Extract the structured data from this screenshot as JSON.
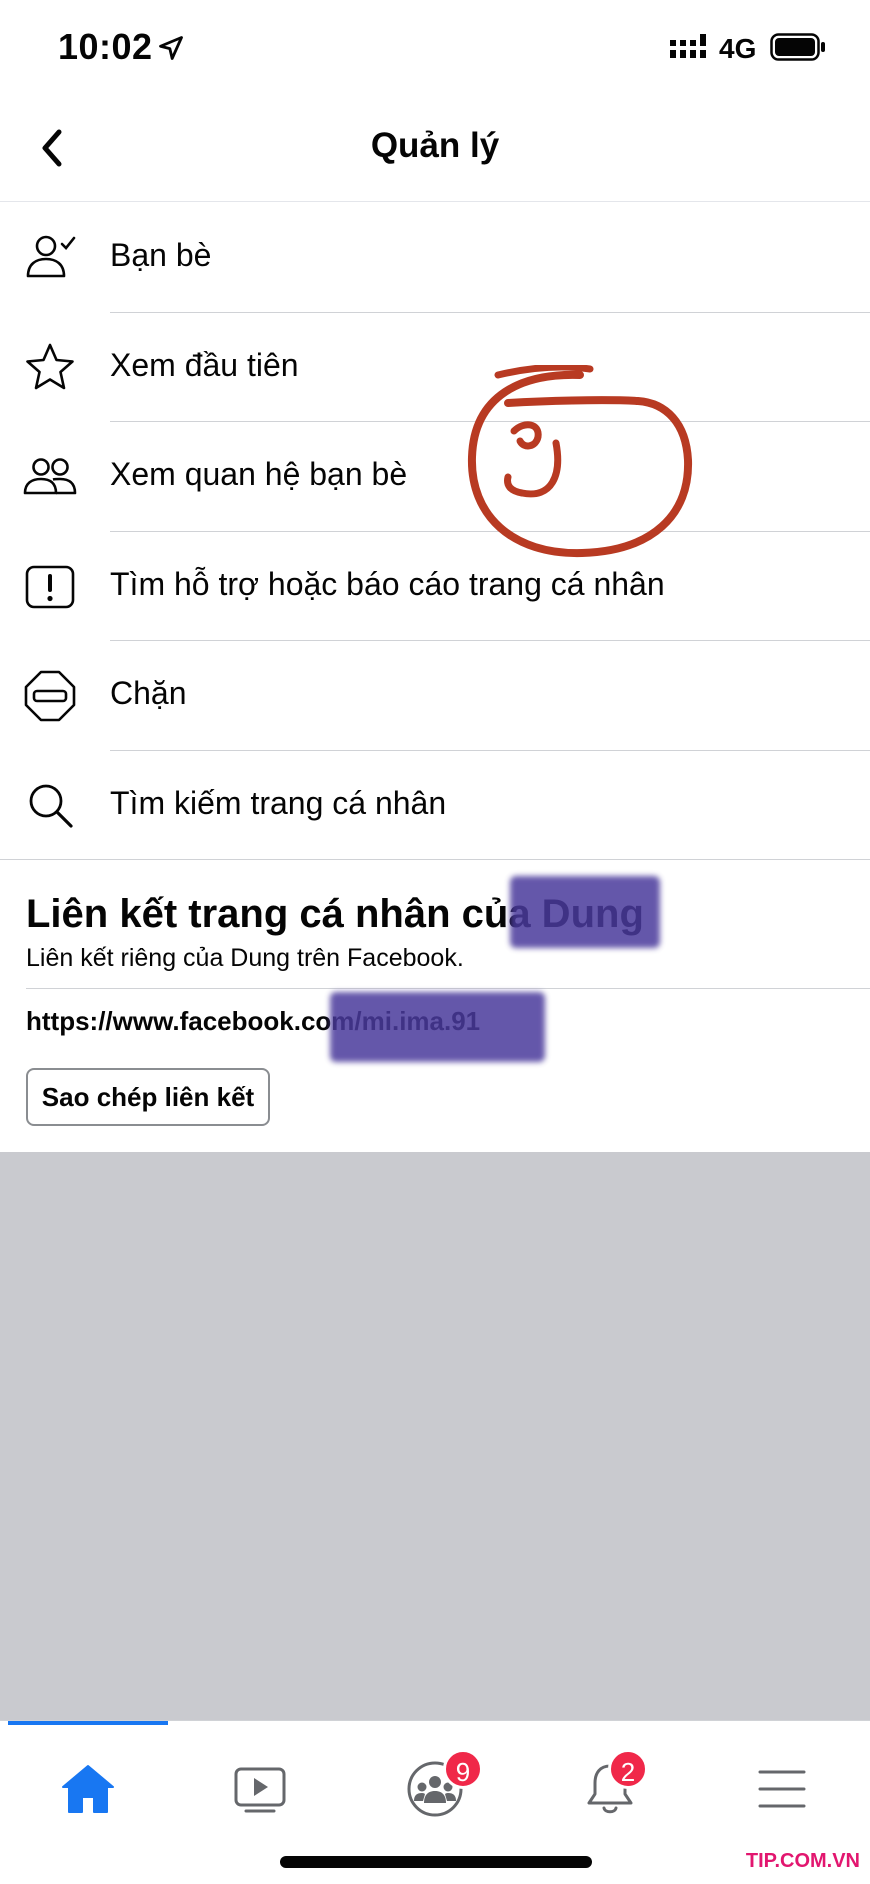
{
  "status_bar": {
    "time": "10:02",
    "network": "4G",
    "icons": [
      "location-arrow-icon",
      "signal-icon",
      "battery-icon"
    ]
  },
  "header": {
    "title": "Quản lý",
    "back_icon": "chevron-left-icon"
  },
  "menu": {
    "items": [
      {
        "label": "Bạn bè",
        "icon": "friend-check-icon"
      },
      {
        "label": "Xem đầu tiên",
        "icon": "star-icon"
      },
      {
        "label": "Xem quan hệ bạn bè",
        "icon": "friends-icon"
      },
      {
        "label": "Tìm hỗ trợ hoặc báo cáo trang cá nhân",
        "icon": "report-icon"
      },
      {
        "label": "Chặn",
        "icon": "block-icon"
      },
      {
        "label": "Tìm kiếm trang cá nhân",
        "icon": "search-icon"
      }
    ]
  },
  "annotation": {
    "mark": "ʖ",
    "color": "#b83a22"
  },
  "link_section": {
    "title": "Liên kết trang cá nhân của Dung",
    "subtitle": "Liên kết riêng của Dung trên Facebook.",
    "url": "https://www.facebook.com/mi.ima.91",
    "copy_button": "Sao chép liên kết"
  },
  "tab_bar": {
    "tabs": [
      {
        "icon": "home-icon",
        "active": true
      },
      {
        "icon": "video-icon"
      },
      {
        "icon": "groups-icon",
        "badge": "9"
      },
      {
        "icon": "bell-icon",
        "badge": "2"
      },
      {
        "icon": "menu-icon"
      }
    ]
  },
  "watermark": "TIP.COM.VN",
  "colors": {
    "accent": "#1877f2",
    "badge": "#f02849",
    "grey_area": "#c9cacf",
    "redaction": "#4a3a9c"
  }
}
